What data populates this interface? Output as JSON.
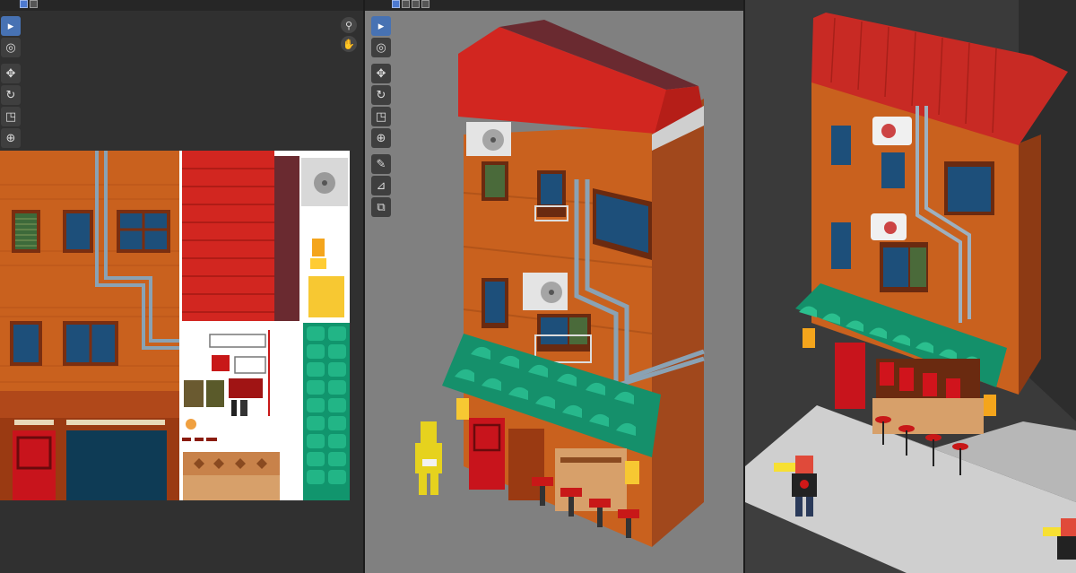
{
  "colors": {
    "uv_editor_bg": "#303030",
    "viewport_bg": "#808080",
    "paintover_bg": "#3a3a3a",
    "active_tool": "#4772b3",
    "facade_orange": "#c9611e",
    "roof_red": "#c82a24",
    "awning_teal": "#1ea57e",
    "window_blue": "#1d4f7a",
    "pipe_gray": "#8aa2b4"
  },
  "uv_editor": {
    "header_icons": [
      "select-box-icon",
      "uv-sync-icon"
    ],
    "tools": [
      {
        "name": "select-box-tool",
        "icon": "▸"
      },
      {
        "name": "cursor-tool",
        "icon": "◎"
      },
      {
        "name": "move-tool",
        "icon": "✥"
      },
      {
        "name": "rotate-tool",
        "icon": "↻"
      },
      {
        "name": "scale-tool",
        "icon": "◳"
      },
      {
        "name": "transform-tool",
        "icon": "⊕"
      },
      {
        "name": "annotate-tool",
        "icon": "✎"
      },
      {
        "name": "grab-tool",
        "icon": "⬚"
      }
    ],
    "nav": [
      {
        "name": "zoom-view-icon",
        "icon": "⚲"
      },
      {
        "name": "pan-view-icon",
        "icon": "✋"
      }
    ]
  },
  "viewport": {
    "header_icons": [
      "object-mode-icon",
      "shading-solid-icon",
      "shading-material-icon",
      "shading-render-icon"
    ],
    "tools": [
      {
        "name": "select-box-tool",
        "icon": "▸"
      },
      {
        "name": "cursor-tool",
        "icon": "◎"
      },
      {
        "name": "move-tool",
        "icon": "✥"
      },
      {
        "name": "rotate-tool",
        "icon": "↻"
      },
      {
        "name": "scale-tool",
        "icon": "◳"
      },
      {
        "name": "transform-tool",
        "icon": "⊕"
      },
      {
        "name": "annotate-tool",
        "icon": "✎"
      },
      {
        "name": "measure-tool",
        "icon": "⊿"
      },
      {
        "name": "add-cube-tool",
        "icon": "⧉"
      }
    ]
  }
}
